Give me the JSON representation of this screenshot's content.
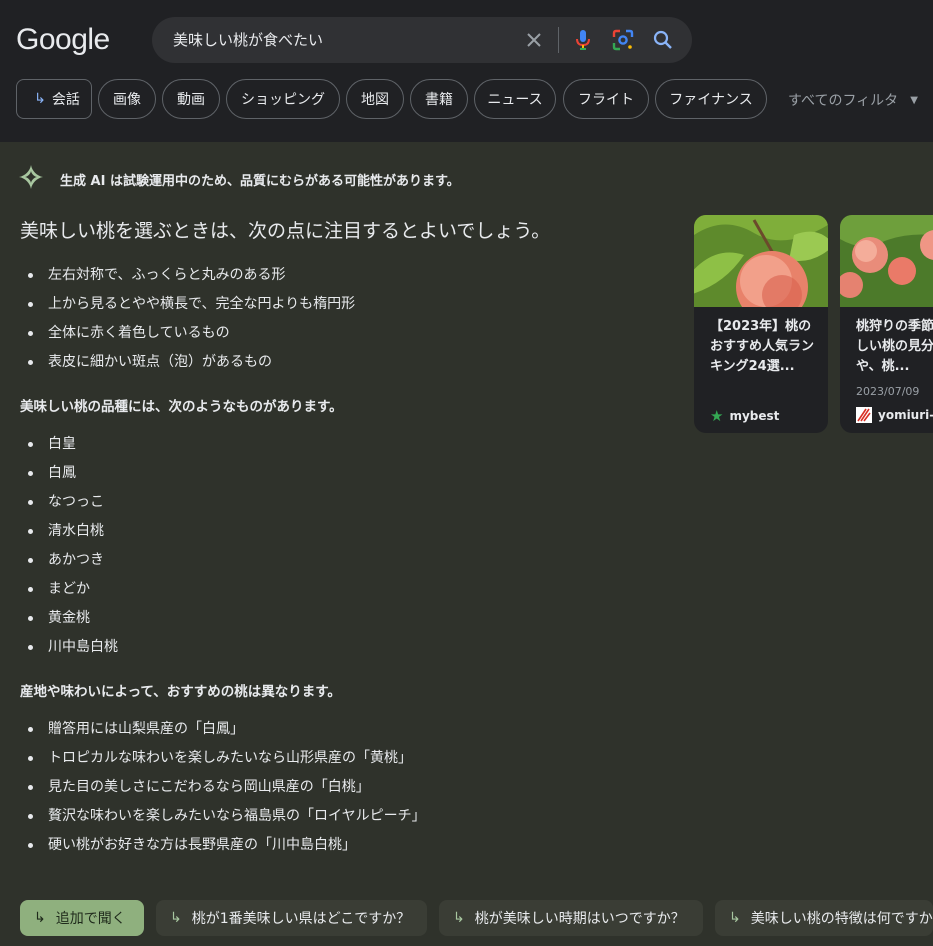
{
  "logo": {
    "text": "Google"
  },
  "search": {
    "query": "美味しい桃が食べたい"
  },
  "icons": [
    "close-icon",
    "microphone-icon",
    "lens-icon",
    "search-icon",
    "reply-arrow-icon",
    "sparkle-icon",
    "star-icon",
    "caret-down-icon"
  ],
  "filters": {
    "chips": [
      "会話",
      "画像",
      "動画",
      "ショッピング",
      "地図",
      "書籍",
      "ニュース",
      "フライト",
      "ファイナンス"
    ],
    "all_filters": "すべてのフィルタ"
  },
  "ai": {
    "notice": "生成 AI は試験運用中のため、品質にむらがある可能性があります。",
    "heading": "美味しい桃を選ぶときは、次の点に注目するとよいでしょう。",
    "points": [
      "左右対称で、ふっくらと丸みのある形",
      "上から見るとやや横長で、完全な円よりも楕円形",
      "全体に赤く着色しているもの",
      "表皮に細かい斑点（泡）があるもの"
    ],
    "varieties_heading": "美味しい桃の品種には、次のようなものがあります。",
    "varieties": [
      "白皇",
      "白鳳",
      "なつっこ",
      "清水白桃",
      "あかつき",
      "まどか",
      "黄金桃",
      "川中島白桃"
    ],
    "regions_heading": "産地や味わいによって、おすすめの桃は異なります。",
    "regions": [
      "贈答用には山梨県産の「白鳳」",
      "トロピカルな味わいを楽しみたいなら山形県産の「黄桃」",
      "見た目の美しさにこだわるなら岡山県産の「白桃」",
      "贅沢な味わいを楽しみたいなら福島県の「ロイヤルピーチ」",
      "硬い桃がお好きな方は長野県産の「川中島白桃」"
    ]
  },
  "cards": [
    {
      "title": "【2023年】桃のおすすめ人気ランキング24選...",
      "date": "",
      "source": "mybest",
      "source_icon": "star-icon",
      "accent": "#34a853"
    },
    {
      "title": "桃狩りの季節！おいしい桃の見分け方や、桃...",
      "date": "2023/07/09",
      "source": "yomiuri-ryokou",
      "source_icon": "yomiuri-logo-icon",
      "accent": "#d93025"
    }
  ],
  "followups": [
    "追加で聞く",
    "桃が1番美味しい県はどこですか？",
    "桃が美味しい時期はいつですか？",
    "美味しい桃の特徴は何ですか？"
  ],
  "colors": {
    "top_bg": "#202124",
    "ai_bg": "#2f322b",
    "accent_green": "#8fb07e",
    "link_blue": "#8ab4f8"
  }
}
